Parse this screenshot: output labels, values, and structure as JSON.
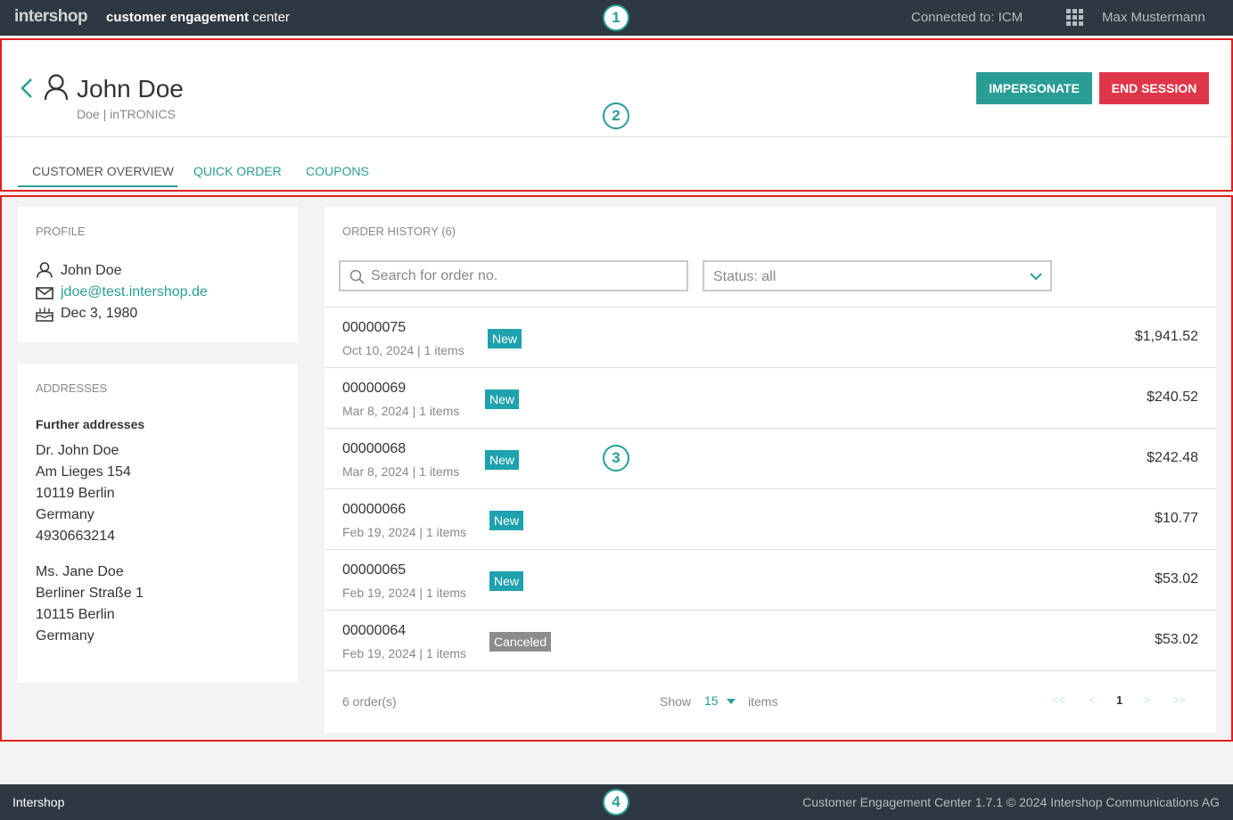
{
  "topbar": {
    "logo": "intershop",
    "app_title_bold": "customer engagement",
    "app_title_rest": "center",
    "connected": "Connected to: ICM",
    "apps_icon": "apps-grid-icon",
    "user": "Max Mustermann"
  },
  "callouts": [
    "1",
    "2",
    "3",
    "4"
  ],
  "header": {
    "back_icon": "chevron-left-icon",
    "person_icon": "user-icon",
    "customer_name": "John Doe",
    "customer_sub": "Doe | inTRONICS",
    "impersonate_label": "IMPERSONATE",
    "end_session_label": "END SESSION"
  },
  "tabs": [
    {
      "label": "CUSTOMER OVERVIEW",
      "active": true
    },
    {
      "label": "QUICK ORDER",
      "active": false
    },
    {
      "label": "COUPONS",
      "active": false
    }
  ],
  "profile": {
    "title": "PROFILE",
    "name": "John Doe",
    "email": "jdoe@test.intershop.de",
    "birthday": "Dec 3, 1980"
  },
  "addresses": {
    "title": "ADDRESSES",
    "further": "Further addresses",
    "list": [
      {
        "lines": [
          "Dr. John Doe",
          "Am Lieges 154",
          "10119 Berlin",
          "Germany",
          "4930663214"
        ]
      },
      {
        "lines": [
          "Ms. Jane Doe",
          "Berliner Straße 1",
          "10115 Berlin",
          "Germany"
        ]
      }
    ]
  },
  "orders": {
    "title": "ORDER HISTORY (6)",
    "search_placeholder": "Search for order no.",
    "status_label": "Status: all",
    "rows": [
      {
        "number": "00000075",
        "date": "Oct 10, 2024",
        "items": "1 items",
        "status": "New",
        "total": "$1,941.52"
      },
      {
        "number": "00000069",
        "date": "Mar 8, 2024",
        "items": "1 items",
        "status": "New",
        "total": "$240.52"
      },
      {
        "number": "00000068",
        "date": "Mar 8, 2024",
        "items": "1 items",
        "status": "New",
        "total": "$242.48"
      },
      {
        "number": "00000066",
        "date": "Feb 19, 2024",
        "items": "1 items",
        "status": "New",
        "total": "$10.77"
      },
      {
        "number": "00000065",
        "date": "Feb 19, 2024",
        "items": "1 items",
        "status": "New",
        "total": "$53.02"
      },
      {
        "number": "00000064",
        "date": "Feb 19, 2024",
        "items": "1 items",
        "status": "Canceled",
        "total": "$53.02"
      }
    ],
    "count": "6 order(s)",
    "show_label": "Show",
    "page_size": "15",
    "items_label": "items",
    "pager": {
      "first": "<<",
      "prev": "<",
      "current": "1",
      "next": ">",
      "last": ">>"
    }
  },
  "footer": {
    "brand": "Intershop",
    "copyright": "Customer Engagement Center 1.7.1 © 2024 Intershop Communications AG"
  },
  "colors": {
    "topbar_bg": "#2e3842",
    "accent": "#2a9d96",
    "end_session": "#e0364a",
    "badge_new": "#1ea2ad",
    "badge_canceled": "#8c8c8c",
    "callout_frame": "#e02020"
  }
}
